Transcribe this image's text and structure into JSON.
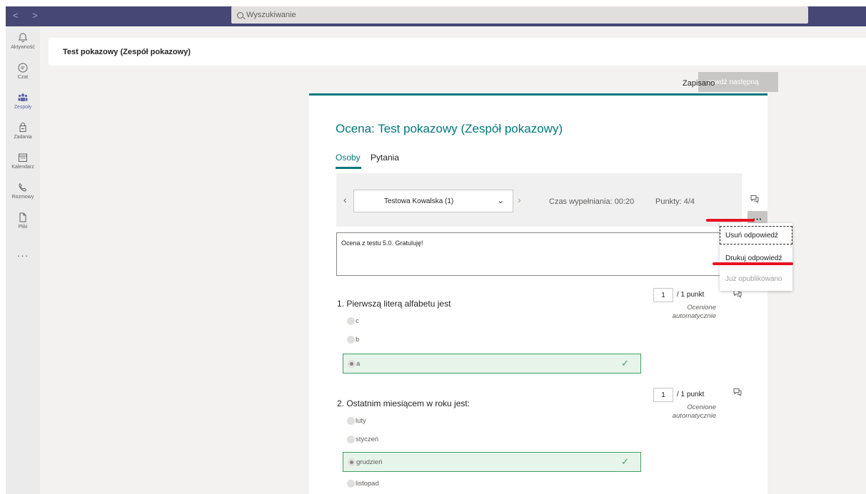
{
  "titlebar": {
    "nav": "< >",
    "search_placeholder": "Wyszukiwanie"
  },
  "rail": {
    "items": [
      {
        "label": "Aktywność",
        "icon": "bell-icon"
      },
      {
        "label": "Czat",
        "icon": "chat-icon"
      },
      {
        "label": "Zespoły",
        "icon": "teams-icon"
      },
      {
        "label": "Zadania",
        "icon": "assignments-icon"
      },
      {
        "label": "Kalendarz",
        "icon": "calendar-icon"
      },
      {
        "label": "Rozmowy",
        "icon": "phone-icon"
      },
      {
        "label": "Pliki",
        "icon": "file-icon"
      }
    ],
    "more": "···",
    "active_color": "#6264a7"
  },
  "header": {
    "title": "Test pokazowy (Zespół pokazowy)"
  },
  "status": {
    "saved": "Zapisano",
    "next_button": "rawdź następną"
  },
  "card": {
    "title": "Ocena: Test pokazowy (Zespół pokazowy)",
    "accent_color": "#03787c",
    "tabs": [
      {
        "label": "Osoby",
        "active": true
      },
      {
        "label": "Pytania",
        "active": false
      }
    ],
    "respondent": "Testowa Kowalska (1)",
    "time_label": "Czas wypełniania: 00:20",
    "points_label": "Punkty: 4/4",
    "more_label": "···",
    "feedback": "Ocena z testu 5.0. Gratuluję!"
  },
  "menu": {
    "items": [
      {
        "label": "Usuń odpowiedź",
        "state": "focused"
      },
      {
        "label": "Drukuj odpowiedź",
        "state": "normal"
      },
      {
        "label": "Już opublikowano",
        "state": "disabled"
      }
    ]
  },
  "questions": [
    {
      "title": "1. Pierwszą literą alfabetu jest",
      "options": [
        "c",
        "b",
        "a"
      ],
      "selected": "a",
      "score": "1",
      "max": "/ 1 punkt",
      "graded": "Ocenione automatycznie"
    },
    {
      "title": "2. Ostatnim miesiącem w roku jest:",
      "options": [
        "luty",
        "styczeń",
        "grudzień",
        "listopad"
      ],
      "selected": "grudzień",
      "score": "1",
      "max": "/ 1 punkt",
      "graded": "Ocenione automatycznie"
    }
  ],
  "colors": {
    "titlebar": "#464775",
    "correct_border": "#3fa063",
    "correct_fill": "#e6f4ea",
    "annotation_red": "#e81123"
  }
}
